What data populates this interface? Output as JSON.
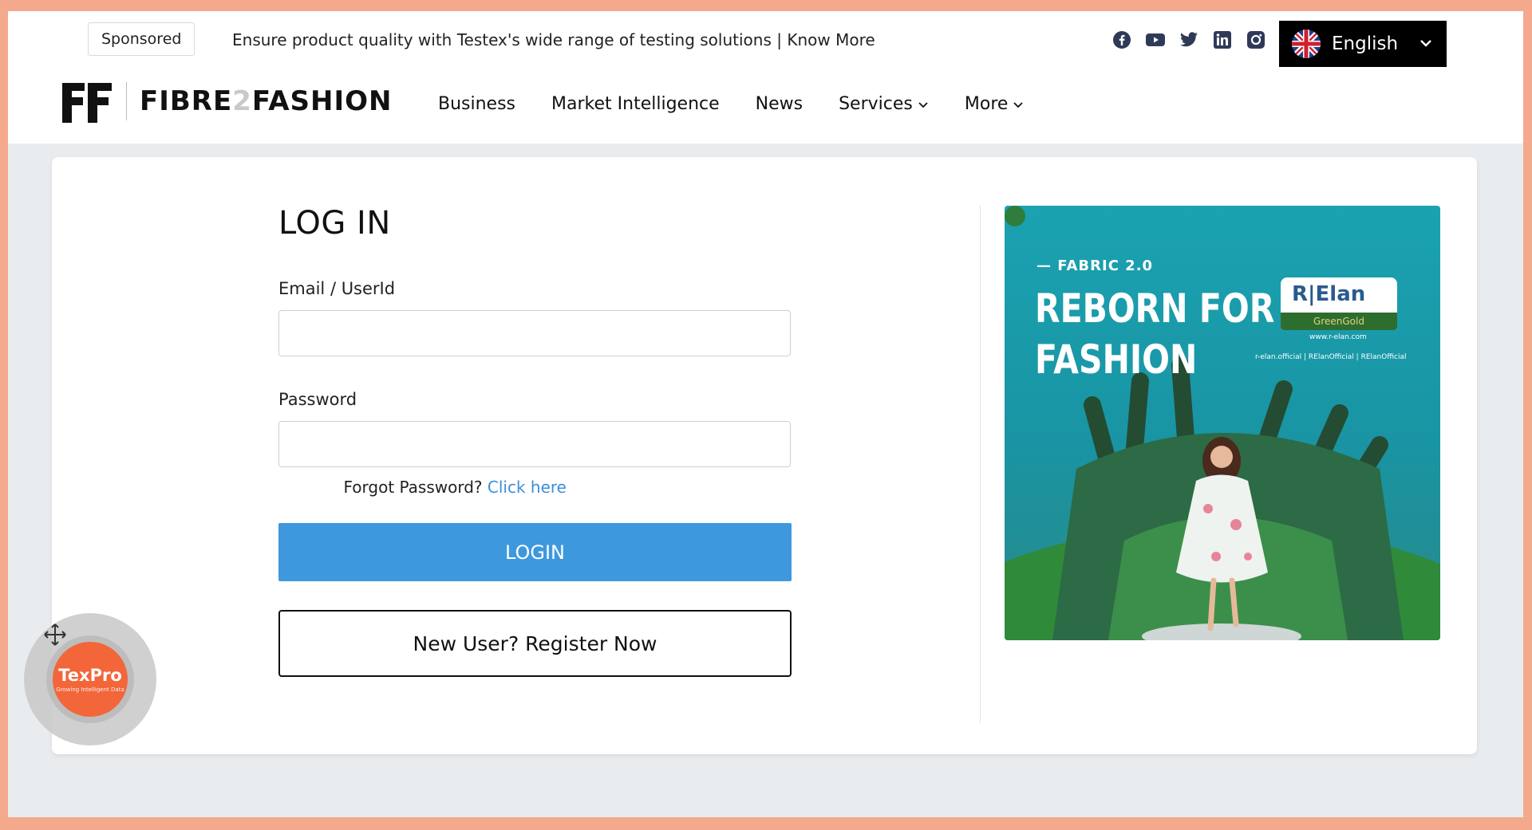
{
  "topbar": {
    "sponsored_label": "Sponsored",
    "sponsored_text": "Ensure product quality with Testex's wide range of testing solutions | Know More",
    "social_icons": [
      "facebook-icon",
      "youtube-icon",
      "twitter-icon",
      "linkedin-icon",
      "instagram-icon"
    ],
    "language": "English"
  },
  "brand": {
    "name_part1": "FIBRE",
    "name_two": "2",
    "name_part2": "FASHION"
  },
  "nav": {
    "items": [
      "Business",
      "Market Intelligence",
      "News",
      "Services",
      "More"
    ]
  },
  "login": {
    "title": "LOG IN",
    "email_label": "Email / UserId",
    "email_value": "",
    "password_label": "Password",
    "password_value": "",
    "forgot_text": "Forgot Password?",
    "forgot_link": "Click here",
    "login_button": "LOGIN",
    "register_button": "New User? Register Now"
  },
  "ad": {
    "kicker": "— FABRIC 2.0",
    "headline_line1": "REBORN FOR",
    "headline_line2": "FASHION",
    "badge_top": "R|Elan",
    "badge_bottom": "GreenGold",
    "url": "www.r-elan.com",
    "social": "r-elan.official | RElanOfficial | RElanOfficial"
  },
  "widget": {
    "brand": "TexPro",
    "tagline": "Growing Intelligent Data"
  },
  "colors": {
    "accent_blue": "#3e98de",
    "link_blue": "#3d8fd8",
    "outer_border": "#f5a98c",
    "widget_orange": "#f2663a"
  }
}
